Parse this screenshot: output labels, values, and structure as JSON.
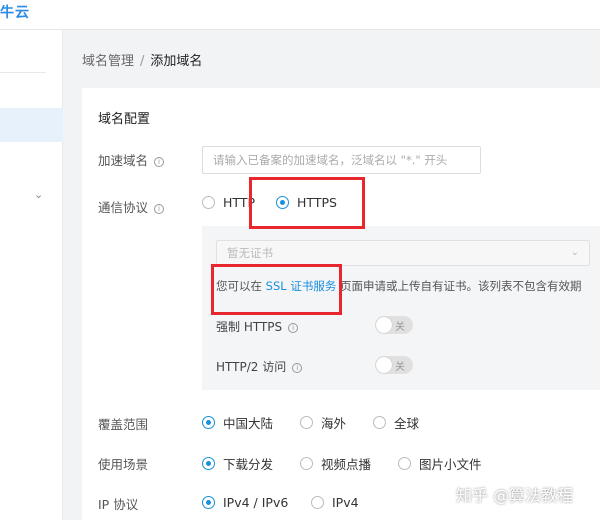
{
  "header": {
    "logo_text": "牛云"
  },
  "breadcrumb": {
    "parent": "域名管理",
    "separator": "/",
    "current": "添加域名"
  },
  "form": {
    "section_title": "域名配置",
    "domain": {
      "label": "加速域名",
      "placeholder": "请输入已备案的加速域名，泛域名以 \"*.\" 开头"
    },
    "protocol": {
      "label": "通信协议",
      "options": [
        "HTTP",
        "HTTPS"
      ],
      "selected": "HTTPS"
    },
    "https": {
      "cert_placeholder": "暂无证书",
      "note_before": "您可以在",
      "note_link": "SSL 证书服务",
      "note_after": "页面申请或上传自有证书。该列表不包含有效期",
      "force_https_label": "强制 HTTPS",
      "http2_label": "HTTP/2 访问",
      "toggle_off_text": "关",
      "force_https_on": false,
      "http2_on": false
    },
    "coverage": {
      "label": "覆盖范围",
      "options": [
        "中国大陆",
        "海外",
        "全球"
      ],
      "selected": "中国大陆"
    },
    "scenario": {
      "label": "使用场景",
      "options": [
        "下载分发",
        "视频点播",
        "图片小文件"
      ],
      "selected": "下载分发"
    },
    "ip_protocol": {
      "label": "IP 协议",
      "options": [
        "IPv4 / IPv6",
        "IPv4"
      ],
      "selected": "IPv4 / IPv6"
    }
  },
  "watermark": "知乎 @算法教程",
  "colors": {
    "accent": "#1a8fdc",
    "highlight": "#e8262e"
  }
}
